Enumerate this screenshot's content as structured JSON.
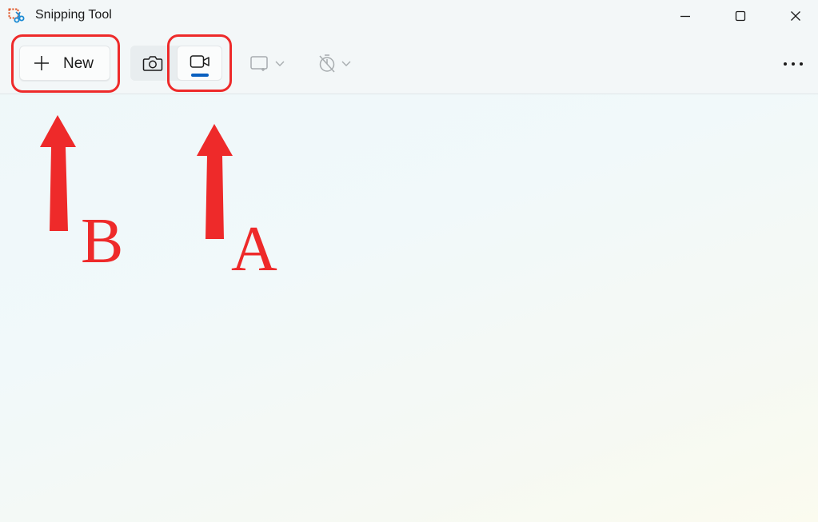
{
  "window": {
    "title": "Snipping Tool",
    "icon": "snipping-tool-icon"
  },
  "window_controls": {
    "minimize_icon": "minimize-icon",
    "maximize_icon": "maximize-icon",
    "close_icon": "close-icon"
  },
  "toolbar": {
    "new_label": "New",
    "new_icon": "plus-icon",
    "modes": [
      {
        "name": "snip",
        "icon": "camera-icon",
        "selected": false
      },
      {
        "name": "record",
        "icon": "video-camera-icon",
        "selected": true
      }
    ],
    "shape_dropdown_icon": "rectangle-snip-icon",
    "timer_dropdown_icon": "no-delay-timer-icon",
    "more_icon": "more-options-icon"
  },
  "annotations": {
    "color": "#ee2a2a",
    "label_b": "B",
    "label_a": "A"
  },
  "colors": {
    "accent": "#0a5fbf",
    "toolbar_bg": "#f3f7f8",
    "annotation": "#ee2a2a"
  }
}
